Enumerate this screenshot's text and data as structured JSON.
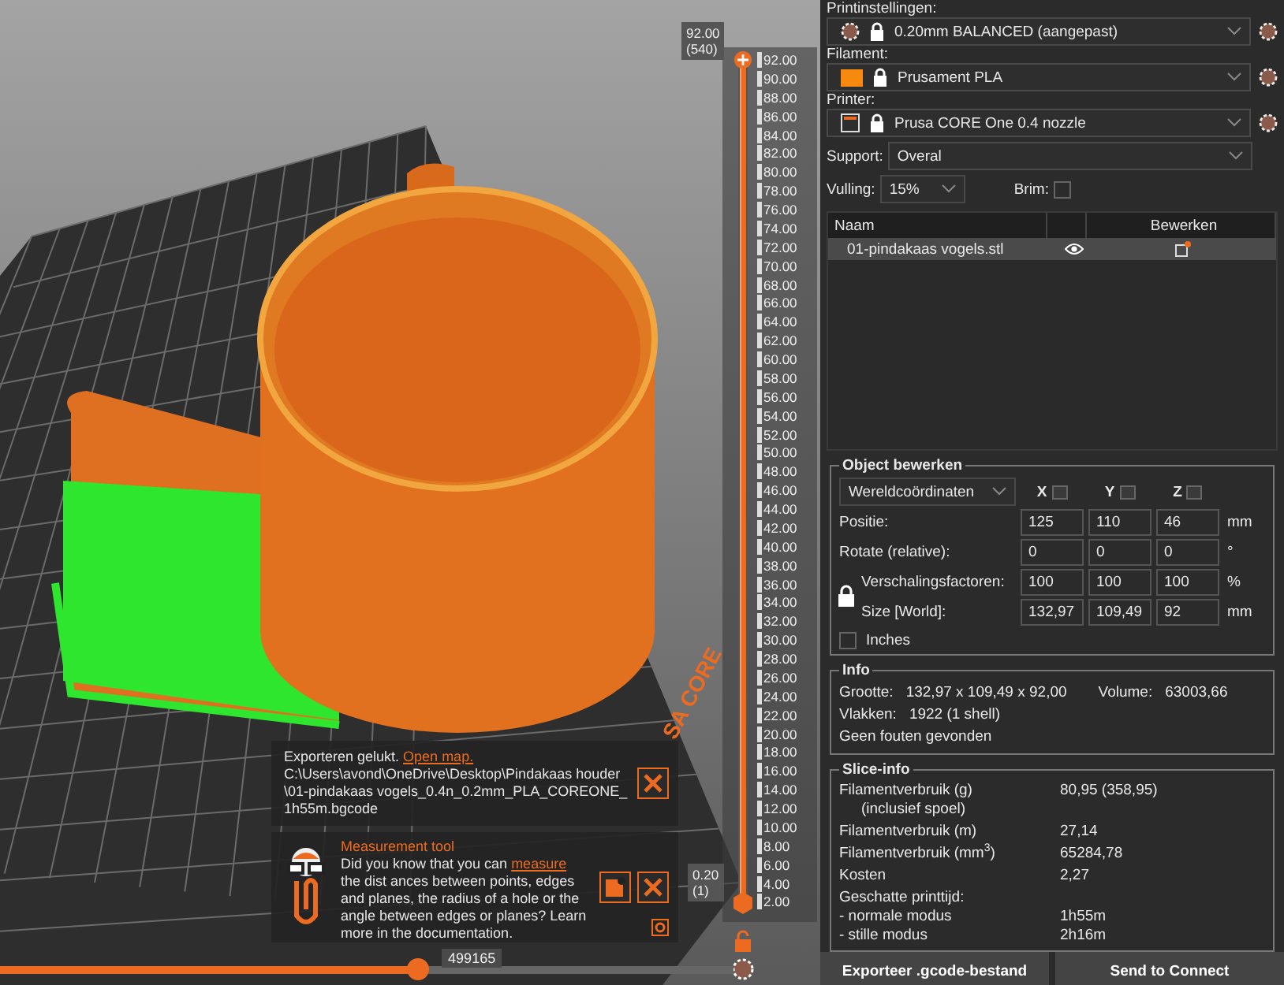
{
  "viewport": {
    "bed_logo": "SA CORE",
    "notifications": [
      {
        "kind": "export",
        "title": "Exporteren gelukt.",
        "link": "Open map.",
        "text": "C:\\Users\\avond\\OneDrive\\Desktop\\Pindakaas houder\\01-pindakaas vogels_0.4n_0.2mm_PLA_COREONE_1h55m.bgcode"
      },
      {
        "kind": "hint",
        "title": "Measurement tool",
        "text_before": "Did you know that you can",
        "link": "measure",
        "text_after": "the dist ances between points, edges and planes, the radius of a hole or the angle between edges or planes? Learn more in the documentation."
      }
    ]
  },
  "layer_slider": {
    "upper_thumb": {
      "level": 1,
      "value": "92.00",
      "layer": "(540)"
    },
    "lower_thumb": {
      "level": 0,
      "value": "0.20",
      "layer": "(1)"
    },
    "ticks": [
      "92.00",
      "90.00",
      "88.00",
      "86.00",
      "84.00",
      "82.00",
      "80.00",
      "78.00",
      "76.00",
      "74.00",
      "72.00",
      "70.00",
      "68.00",
      "66.00",
      "64.00",
      "62.00",
      "60.00",
      "58.00",
      "56.00",
      "54.00",
      "52.00",
      "50.00",
      "48.00",
      "46.00",
      "44.00",
      "42.00",
      "40.00",
      "38.00",
      "36.00",
      "34.00",
      "32.00",
      "30.00",
      "28.00",
      "26.00",
      "24.00",
      "22.00",
      "20.00",
      "18.00",
      "16.00",
      "14.00",
      "12.00",
      "10.00",
      "8.00",
      "6.00",
      "4.00",
      "2.00"
    ]
  },
  "move_slider": {
    "level": 0.57,
    "value": "499165"
  },
  "presets": [
    {
      "kind": "print",
      "label": "Printinstellingen:",
      "value": "0.20mm BALANCED (aangepast)"
    },
    {
      "kind": "filament",
      "label": "Filament:",
      "value": "Prusament PLA",
      "color": "#f7890f"
    },
    {
      "kind": "printer",
      "label": "Printer:",
      "value": "Prusa CORE One 0.4 nozzle"
    }
  ],
  "support": {
    "label": "Support:",
    "value": "Overal"
  },
  "infill": {
    "label": "Vulling:",
    "value": "15%"
  },
  "brim": {
    "label": "Brim:",
    "checked": false
  },
  "objects": {
    "columns": {
      "name": "Naam",
      "edit": "Bewerken"
    },
    "rows": [
      {
        "name": "01-pindakaas vogels.stl",
        "visible": true,
        "selected": true
      }
    ]
  },
  "object_edit": {
    "title": "Object bewerken",
    "coordinates": "Wereldcoördinaten",
    "axes": [
      "X",
      "Y",
      "Z"
    ],
    "rows": [
      {
        "label": "Positie:",
        "values": [
          "125",
          "110",
          "46"
        ],
        "unit": "mm"
      },
      {
        "label": "Rotate (relative):",
        "values": [
          "0",
          "0",
          "0"
        ],
        "unit": "°"
      }
    ],
    "scale": {
      "locked": true,
      "rows": [
        {
          "label": "Verschalingsfactoren:",
          "values": [
            "100",
            "100",
            "100"
          ],
          "unit": "%"
        },
        {
          "label": "Size [World]:",
          "values": [
            "132,97",
            "109,49",
            "92"
          ],
          "unit": "mm"
        }
      ]
    },
    "inches": {
      "label": "Inches",
      "checked": false
    }
  },
  "info": {
    "title": "Info",
    "lines": [
      {
        "fields": [
          {
            "label": "Grootte:",
            "value": "132,97 x 109,49 x 92,00"
          },
          {
            "label": "Volume:",
            "value": "63003,66"
          }
        ]
      },
      {
        "fields": [
          {
            "label": "Vlakken:",
            "value": "1922 (1 shell)"
          }
        ]
      }
    ],
    "status": "Geen fouten gevonden"
  },
  "slice_info": {
    "title": "Slice-info",
    "rows": [
      {
        "label": "Filamentverbruik (g)",
        "sublabel": "(inclusief spoel)",
        "value": "80,95 (358,95)"
      },
      {
        "label": "Filamentverbruik (m)",
        "value": "27,14"
      },
      {
        "label": "Filamentverbruik (mm$^{3}$)",
        "value": "65284,78"
      },
      {
        "label": "Kosten",
        "value": "2,27"
      }
    ],
    "time": {
      "label": "Geschatte printtijd:",
      "modes": [
        {
          "label": "- normale modus",
          "value": "1h55m"
        },
        {
          "label": "- stille modus",
          "value": "2h16m"
        }
      ]
    }
  },
  "buttons": [
    "Exporteer .gcode-bestand",
    "Send to Connect"
  ]
}
